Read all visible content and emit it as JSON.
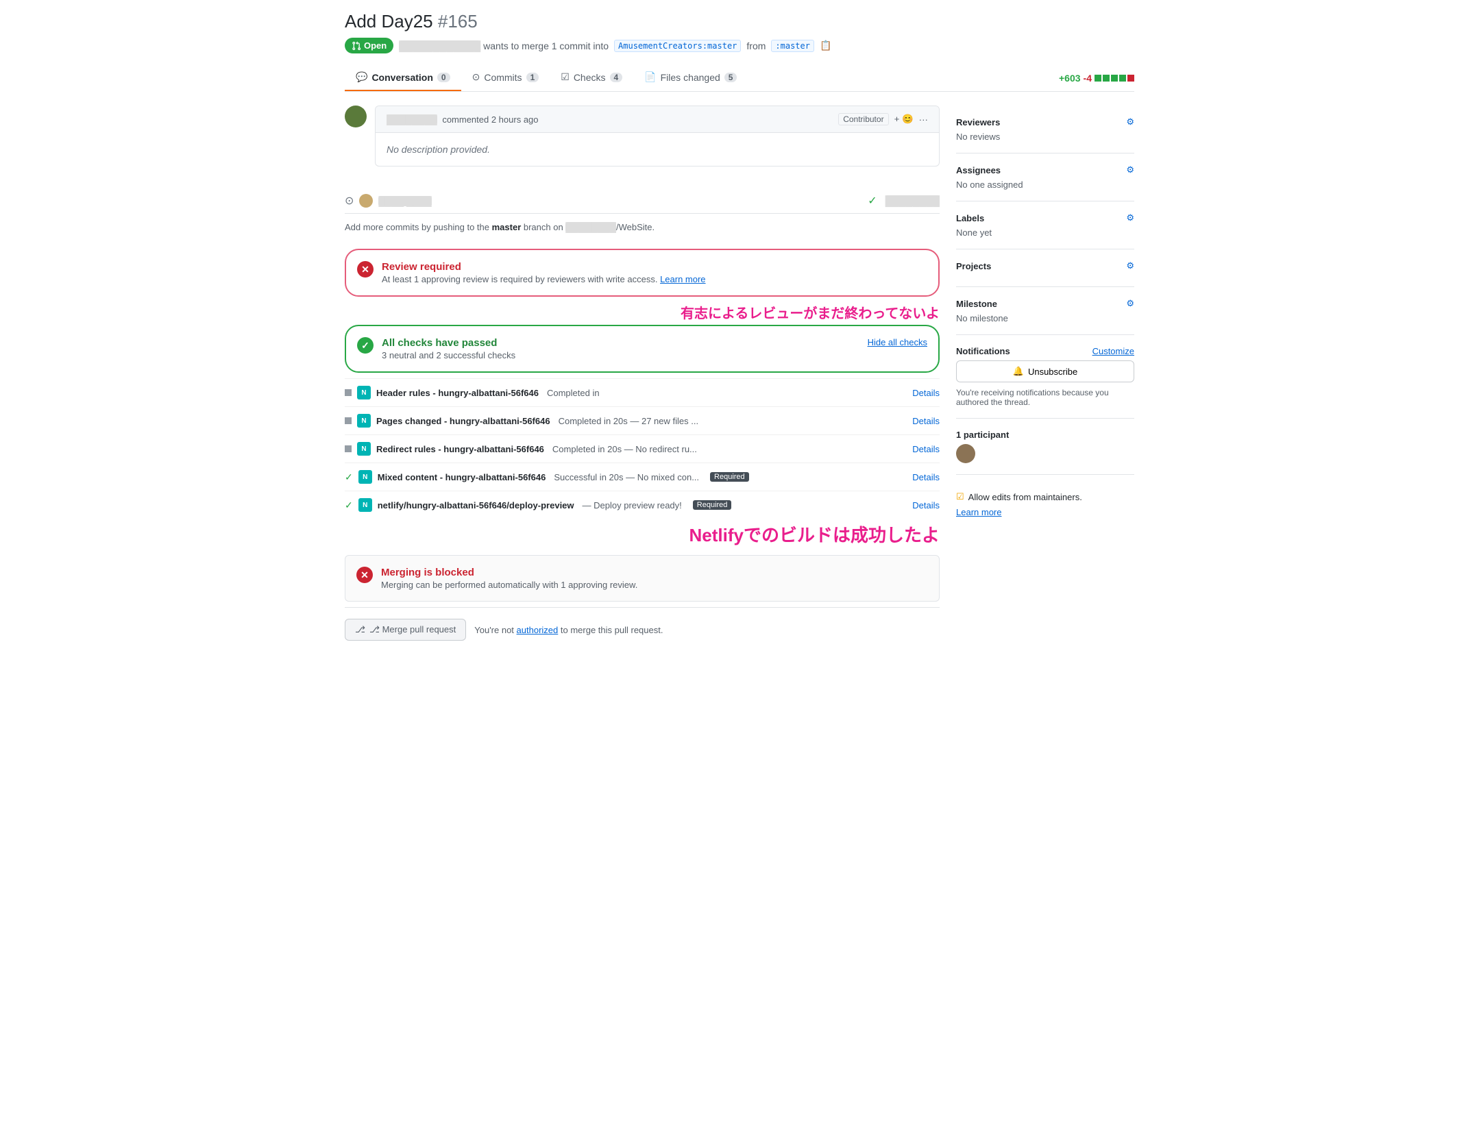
{
  "header": {
    "title": "Add Day25",
    "pr_number": "#165",
    "status": "Open",
    "status_icon": "⎇",
    "meta": "wants to merge 1 commit into",
    "target_branch": "AmusementCreators:master",
    "source_branch": "from",
    "source_branch_name": ":master"
  },
  "tabs": [
    {
      "id": "conversation",
      "label": "Conversation",
      "icon": "💬",
      "count": "0",
      "active": true
    },
    {
      "id": "commits",
      "label": "Commits",
      "icon": "⊙",
      "count": "1",
      "active": false
    },
    {
      "id": "checks",
      "label": "Checks",
      "icon": "☑",
      "count": "4",
      "active": false
    },
    {
      "id": "files",
      "label": "Files changed",
      "icon": "📄",
      "count": "5",
      "active": false
    }
  ],
  "diff_stat": {
    "additions": "+603",
    "deletions": "-4",
    "blocks_green": 4,
    "blocks_red": 1
  },
  "comment": {
    "author": "commented 2 hours ago",
    "badge": "Contributor",
    "body": "No description provided.",
    "emoji_btn": "+ 😊",
    "more_btn": "···"
  },
  "commit": {
    "names": "██████  ██████",
    "check_icon": "✓",
    "blurred_name": "██████"
  },
  "branch_info": "Add more commits by pushing to the master branch on ██████/WebSite.",
  "review_block": {
    "title": "Review required",
    "desc": "At least 1 approving review is required by reviewers with write access. Learn more.",
    "desc_link": "Learn more"
  },
  "checks_block": {
    "title": "All checks have passed",
    "desc": "3 neutral and 2 successful checks",
    "hide_label": "Hide all checks"
  },
  "checks": [
    {
      "status": "neutral",
      "name": "Header rules - hungry-albattani-56f646",
      "detail": "Completed in",
      "link": "Details"
    },
    {
      "status": "neutral",
      "name": "Pages changed - hungry-albattani-56f646",
      "detail": "Completed in 20s — 27 new files ...",
      "link": "Details"
    },
    {
      "status": "neutral",
      "name": "Redirect rules - hungry-albattani-56f646",
      "detail": "Completed in 20s — No redirect ru...",
      "link": "Details"
    },
    {
      "status": "success",
      "name": "Mixed content - hungry-albattani-56f646",
      "detail": "Successful in 20s — No mixed con...",
      "required": "Required",
      "link": "Details"
    },
    {
      "status": "success",
      "name": "netlify/hungry-albattani-56f646/deploy-preview",
      "detail": "— Deploy preview ready!",
      "required": "Required",
      "link": "Details"
    }
  ],
  "blocking": {
    "title": "Merging is blocked",
    "desc": "Merging can be performed automatically with 1 approving review."
  },
  "merge": {
    "button": "⎇ Merge pull request",
    "note_prefix": "You're not",
    "note_link": "authorized",
    "note_suffix": "to merge this pull request."
  },
  "sidebar": {
    "reviewers_label": "Reviewers",
    "reviewers_value": "No reviews",
    "assignees_label": "Assignees",
    "assignees_value": "No one assigned",
    "labels_label": "Labels",
    "labels_value": "None yet",
    "projects_label": "Projects",
    "projects_value": "",
    "milestone_label": "Milestone",
    "milestone_value": "No milestone",
    "notifications_label": "Notifications",
    "customize_label": "Customize",
    "unsub_btn": "🔔 Unsubscribe",
    "unsub_note": "You're receiving notifications because you authored the thread.",
    "participants_label": "1 participant",
    "checkbox_label": "Allow edits from maintainers.",
    "learn_more": "Learn more"
  },
  "annotations": {
    "jp1": "有志によるレビューがまだ終わってないよ",
    "jp2": "Netlifyでのビルドは成功したよ"
  }
}
